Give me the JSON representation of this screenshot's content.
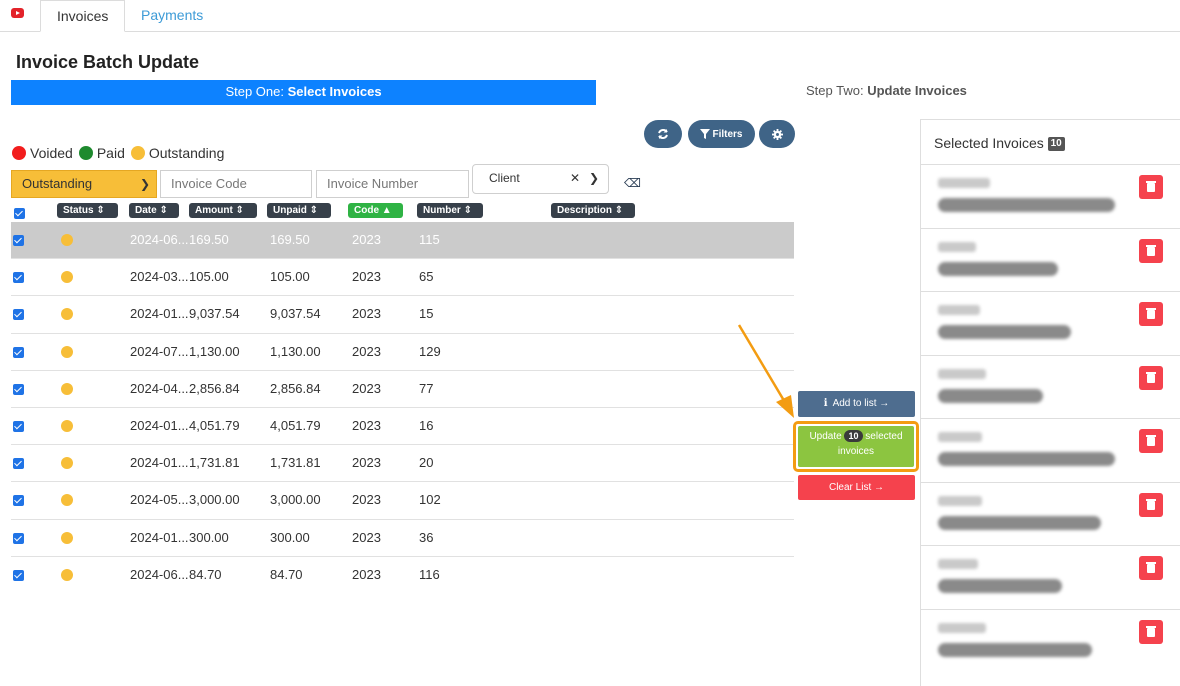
{
  "tabs": [
    "Invoices",
    "Payments"
  ],
  "title": "Invoice Batch Update",
  "step_one": {
    "prefix": "Step One:",
    "bold": "Select Invoices"
  },
  "step_two": {
    "prefix": "Step Two:",
    "bold": "Update Invoices"
  },
  "toolbar": {
    "refresh_icon": "refresh-icon",
    "filters_label": "Filters",
    "settings_icon": "gear-icon"
  },
  "legend": [
    {
      "label": "Voided",
      "color": "#f21d1d"
    },
    {
      "label": "Paid",
      "color": "#1e8a2e"
    },
    {
      "label": "Outstanding",
      "color": "#f7be38"
    }
  ],
  "filters": {
    "status_value": "Outstanding",
    "invoice_code_placeholder": "Invoice Code",
    "invoice_number_placeholder": "Invoice Number",
    "client_label": "Client"
  },
  "columns": [
    "Status",
    "Date",
    "Amount",
    "Unpaid",
    "Code",
    "Number",
    "Description"
  ],
  "rows": [
    {
      "date": "2024-06...",
      "amount": "169.50",
      "unpaid": "169.50",
      "code": "2023",
      "number": "115"
    },
    {
      "date": "2024-03...",
      "amount": "105.00",
      "unpaid": "105.00",
      "code": "2023",
      "number": "65"
    },
    {
      "date": "2024-01...",
      "amount": "9,037.54",
      "unpaid": "9,037.54",
      "code": "2023",
      "number": "15"
    },
    {
      "date": "2024-07...",
      "amount": "1,130.00",
      "unpaid": "1,130.00",
      "code": "2023",
      "number": "129"
    },
    {
      "date": "2024-04...",
      "amount": "2,856.84",
      "unpaid": "2,856.84",
      "code": "2023",
      "number": "77"
    },
    {
      "date": "2024-01...",
      "amount": "4,051.79",
      "unpaid": "4,051.79",
      "code": "2023",
      "number": "16"
    },
    {
      "date": "2024-01...",
      "amount": "1,731.81",
      "unpaid": "1,731.81",
      "code": "2023",
      "number": "20"
    },
    {
      "date": "2024-05...",
      "amount": "3,000.00",
      "unpaid": "3,000.00",
      "code": "2023",
      "number": "102"
    },
    {
      "date": "2024-01...",
      "amount": "300.00",
      "unpaid": "300.00",
      "code": "2023",
      "number": "36"
    },
    {
      "date": "2024-06...",
      "amount": "84.70",
      "unpaid": "84.70",
      "code": "2023",
      "number": "116"
    }
  ],
  "actions": {
    "add_label": "Add to list",
    "update_prefix": "Update",
    "update_count": "10",
    "update_suffix": "selected",
    "update_line2": "invoices",
    "clear_label": "Clear List"
  },
  "selected_panel": {
    "title": "Selected Invoices",
    "count": "10"
  }
}
